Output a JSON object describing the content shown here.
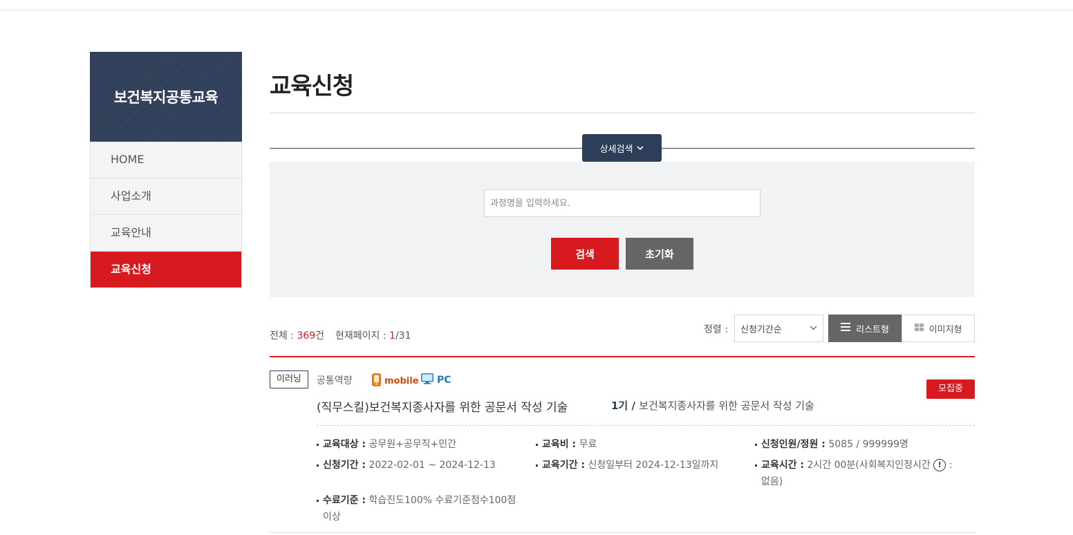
{
  "sidebar": {
    "title": "보건복지공통교육",
    "items": [
      {
        "label": "HOME",
        "active": false
      },
      {
        "label": "사업소개",
        "active": false
      },
      {
        "label": "교육안내",
        "active": false
      },
      {
        "label": "교육신청",
        "active": true
      }
    ]
  },
  "page": {
    "title": "교육신청"
  },
  "search": {
    "advanced_label": "상세검색",
    "advanced_icon": "chevron-down-icon",
    "placeholder": "과정명을 입력하세요.",
    "value": "",
    "search_button": "검색",
    "reset_button": "초기화"
  },
  "summary": {
    "total_label": "전체 : ",
    "total_count": "369",
    "total_unit": "건",
    "page_label": "현재페이지 : ",
    "current_page": "1",
    "total_pages": "/31"
  },
  "sort": {
    "label": "정렬 :",
    "selected": "신청기간순",
    "list_view_label": "리스트형",
    "image_view_label": "이미지형"
  },
  "colors": {
    "navy": "#2f3e58",
    "red": "#d71920",
    "gray_button": "#666666"
  },
  "courses": [
    {
      "type_tag": "이러닝",
      "category": "공통역량",
      "devices": {
        "mobile": "mobile",
        "pc": "PC"
      },
      "status": "모집중",
      "title": "(직무스킬)보건복지종사자를 위한 공문서 작성 기술",
      "round": "1기",
      "separator": " / ",
      "subtitle": "보건복지종사자를 위한 공문서 작성 기술",
      "info": {
        "target_label": "교육대상 :",
        "target": "공무원+공무직+민간",
        "fee_label": "교육비 :",
        "fee": "무료",
        "capacity_label": "신청인원/정원 :",
        "capacity": "5085 / 999999명",
        "apply_period_label": "신청기간 :",
        "apply_period": "2022-02-01 ~ 2024-12-13",
        "edu_period_label": "교육기간 :",
        "edu_period": "신청일부터 2024-12-13일까지",
        "edu_time_label": "교육시간 :",
        "edu_time": "2시간 00분(사회복지인정시간",
        "edu_time_help": "!",
        "edu_time_rest": ":",
        "edu_time_value": "없음)",
        "completion_label": "수료기준 :",
        "completion": "학습진도100% 수료기준점수100점",
        "completion_rest": "이상"
      }
    }
  ]
}
